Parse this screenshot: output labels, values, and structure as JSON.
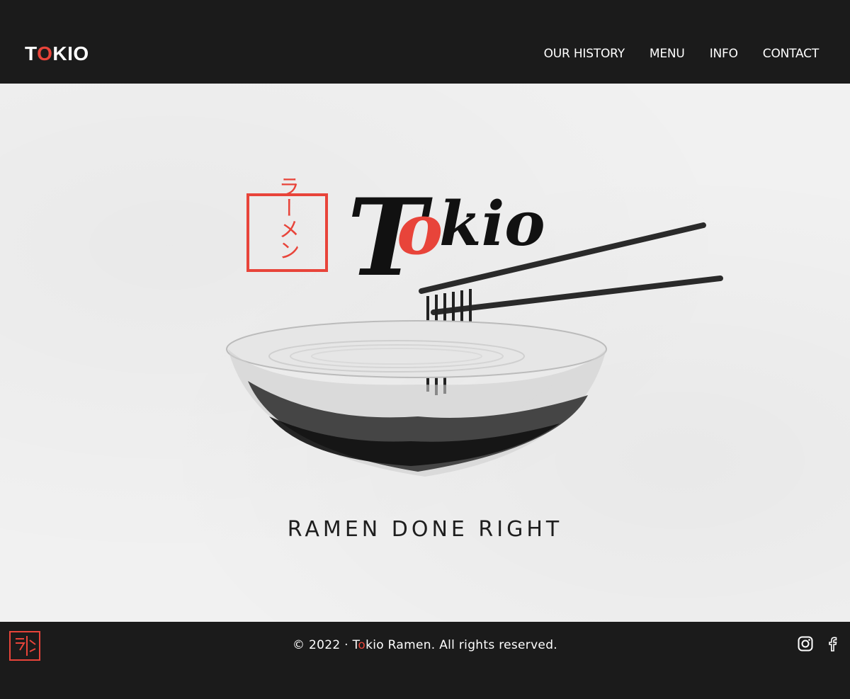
{
  "header": {
    "brand_prefix": "T",
    "brand_accent": "O",
    "brand_suffix": "KIO",
    "nav": [
      "OUR HISTORY",
      "MENU",
      "INFO",
      "CONTACT"
    ]
  },
  "hero": {
    "logo_prefix": "T",
    "logo_accent": "o",
    "logo_suffix": "kio",
    "stamp_text": "ラーメン",
    "tagline": "RAMEN DONE RIGHT"
  },
  "footer": {
    "copy_prefix": "© 2022 · T",
    "copy_accent": "o",
    "copy_suffix": "kio Ramen. All rights reserved.",
    "social_icons": [
      "instagram-icon",
      "facebook-icon"
    ]
  },
  "colors": {
    "accent": "#e8443a",
    "dark": "#1b1b1b",
    "paper": "#f1f1f1"
  }
}
